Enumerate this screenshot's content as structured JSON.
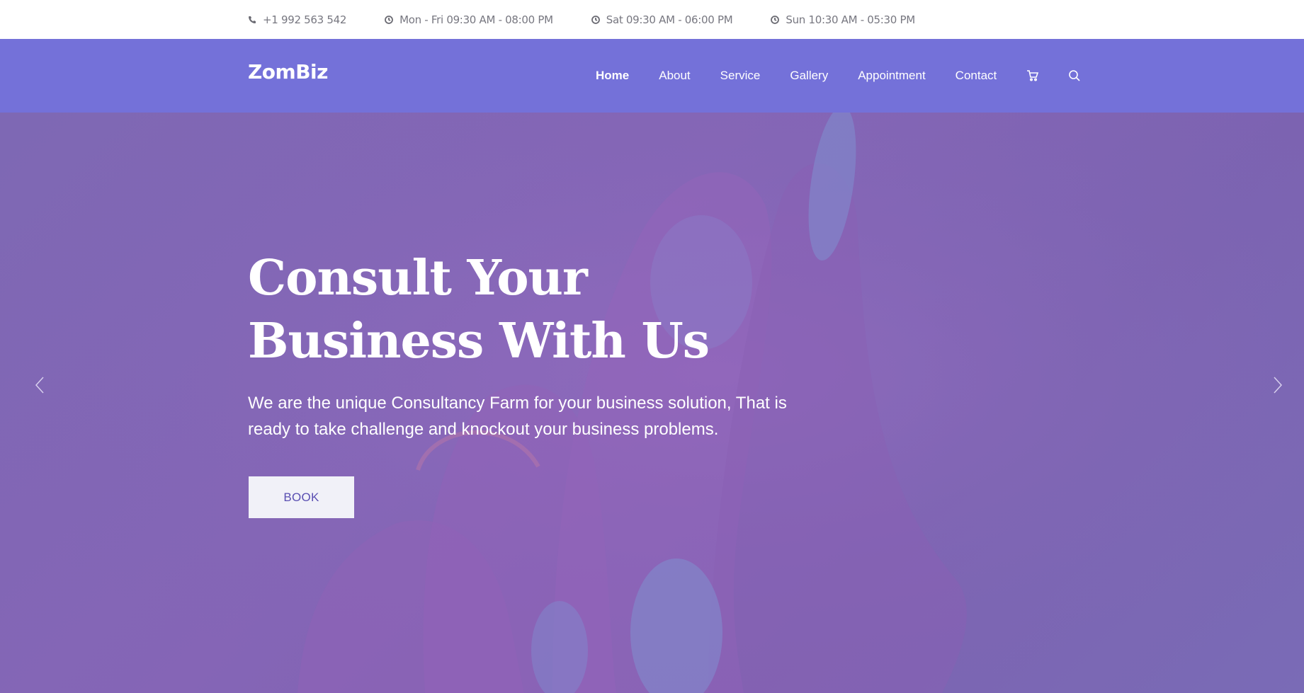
{
  "topbar": {
    "phone": "+1 992 563 542",
    "hours_weekday": "Mon - Fri 09:30 AM - 08:00 PM",
    "hours_saturday": "Sat 09:30 AM - 06:00 PM",
    "hours_sunday": "Sun 10:30 AM - 05:30 PM",
    "icons": {
      "phone": "phone-icon",
      "clock": "clock-icon"
    }
  },
  "header": {
    "logo": "ZomBiz",
    "nav": [
      {
        "label": "Home",
        "active": true
      },
      {
        "label": "About"
      },
      {
        "label": "Service"
      },
      {
        "label": "Gallery"
      },
      {
        "label": "Appointment"
      },
      {
        "label": "Contact"
      }
    ],
    "icons": {
      "cart": "cart-icon",
      "search": "search-icon"
    }
  },
  "hero": {
    "title_line1": "Consult Your",
    "title_line2": "Business With Us",
    "description": "We are the unique Consultancy Farm for your business solution, That is ready to take challenge and knockout your business problems.",
    "button_label": "BOOK",
    "icons": {
      "prev": "chevron-left-icon",
      "next": "chevron-right-icon"
    }
  },
  "colors": {
    "nav_background": "#7471d9",
    "hero_overlay": "#7e68b4",
    "button_text": "#5a4fb2"
  }
}
